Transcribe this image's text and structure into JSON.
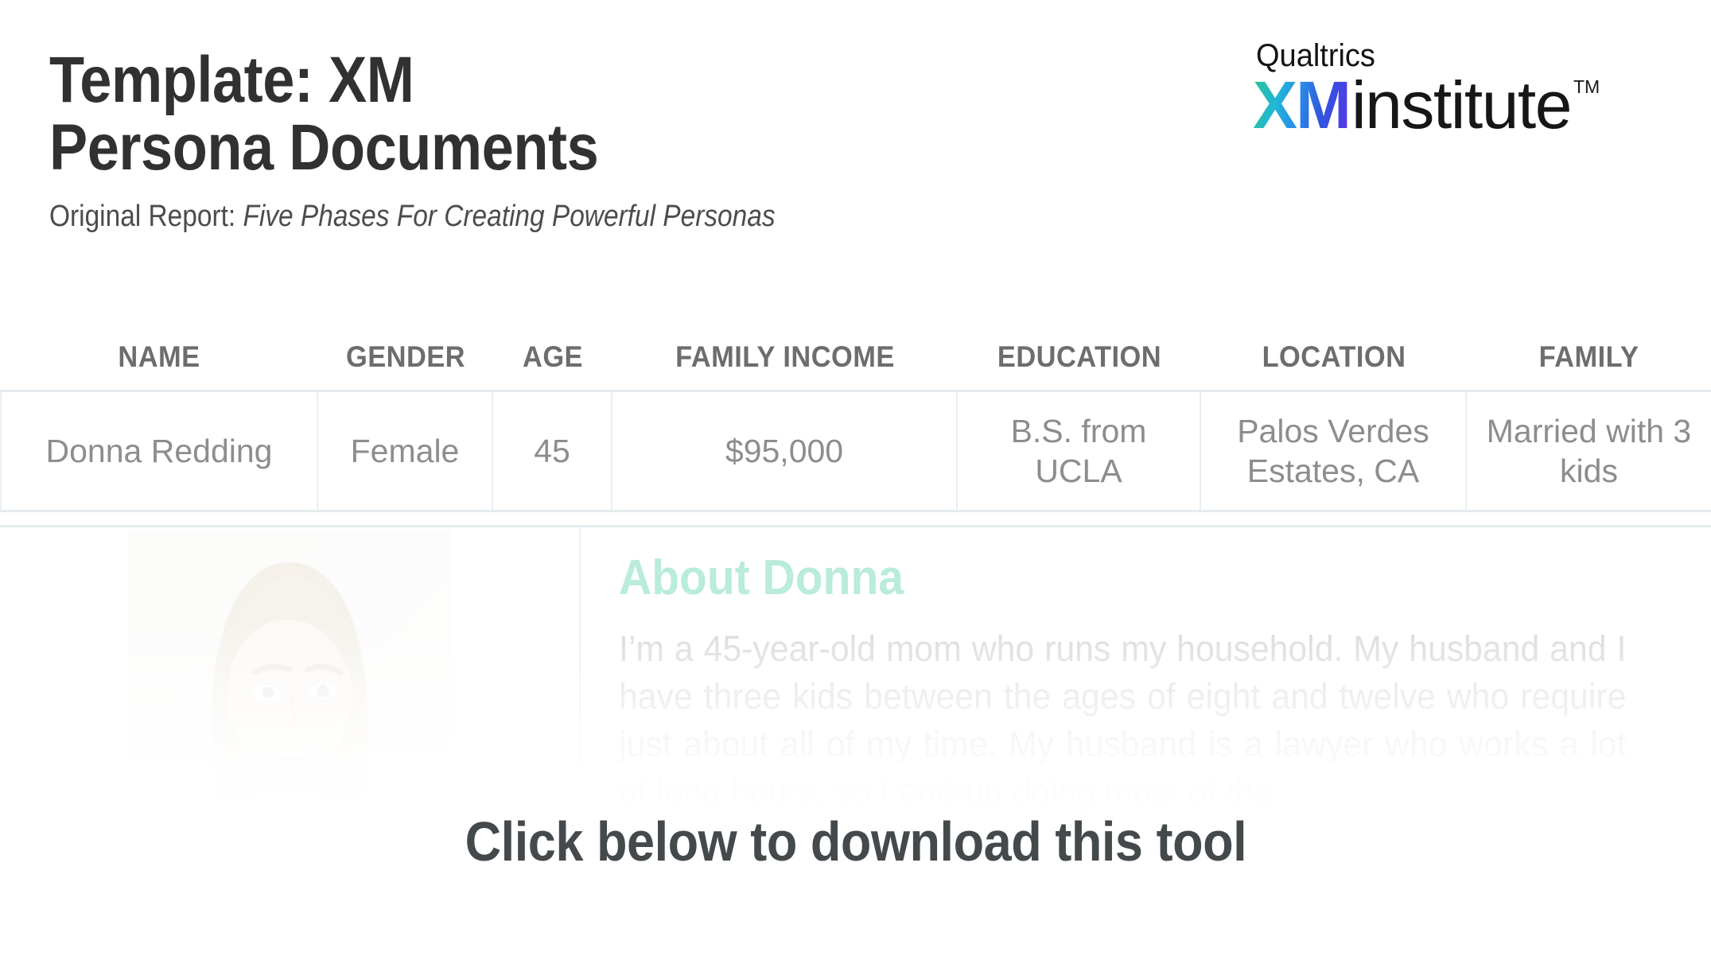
{
  "document": {
    "title_line1": "Template: XM",
    "title_line2": "Persona Documents",
    "title_full": "Template: XM\nPersona Documents",
    "subtitle_lead": "Original Report: ",
    "subtitle_report": "Five Phases For Creating Powerful Personas"
  },
  "logo": {
    "brand": "Qualtrics",
    "xm": "XM",
    "institute": "institute",
    "trademark": "TM",
    "gradient_start": "#29c48f",
    "gradient_mid1": "#22b6d9",
    "gradient_mid2": "#2a8ee8",
    "gradient_end": "#5b34e8",
    "wordmark_color": "#141618"
  },
  "table": {
    "headers": [
      "NAME",
      "GENDER",
      "AGE",
      "FAMILY INCOME",
      "EDUCATION",
      "LOCATION",
      "FAMILY"
    ],
    "rows": [
      {
        "name": "Donna Redding",
        "gender": "Female",
        "age": "45",
        "family_income": "$95,000",
        "education": "B.S. from UCLA",
        "location": "Palos Verdes Estates, CA",
        "family": "Married with 3 kids"
      }
    ],
    "header_color": "#6b6d6f",
    "cell_color": "#8b8d8f",
    "border_color": "#e6ecef"
  },
  "detail": {
    "photo_alt": "persona-portrait",
    "about_heading": "About Donna",
    "about_heading_color": "#b9ecd9",
    "about_body": "I’m a 45-year-old mom who runs my household. My husband and I have three kids between the ages of eight and twelve who require just about all of my time. My husband is a lawyer who works a lot of long hours, so I end up doing most of the",
    "about_body_color": "#d9dada"
  },
  "cta": {
    "text": "Click below to download this tool",
    "color": "#44494c"
  }
}
